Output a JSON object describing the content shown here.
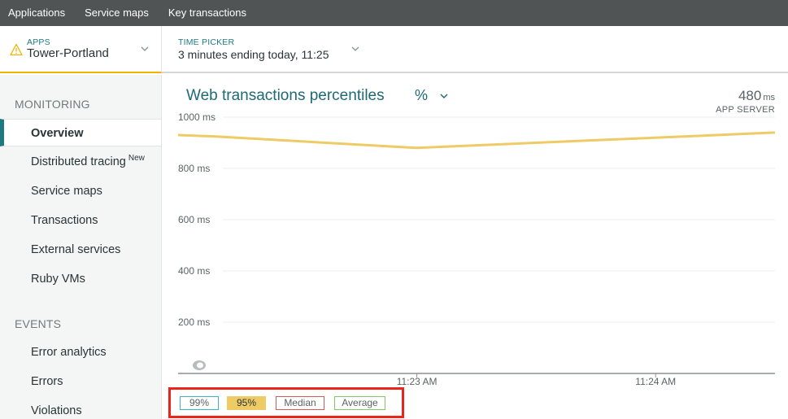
{
  "topnav": [
    "Applications",
    "Service maps",
    "Key transactions"
  ],
  "apps": {
    "label": "APPS",
    "name": "Tower-Portland"
  },
  "timepicker": {
    "label": "TIME PICKER",
    "value": "3 minutes ending today, 11:25"
  },
  "sidebar": {
    "monitoring_title": "MONITORING",
    "monitoring_items": [
      {
        "label": "Overview",
        "badge": ""
      },
      {
        "label": "Distributed tracing",
        "badge": "New"
      },
      {
        "label": "Service maps",
        "badge": ""
      },
      {
        "label": "Transactions",
        "badge": ""
      },
      {
        "label": "External services",
        "badge": ""
      },
      {
        "label": "Ruby VMs",
        "badge": ""
      }
    ],
    "events_title": "EVENTS",
    "events_items": [
      {
        "label": "Error analytics"
      },
      {
        "label": "Errors"
      },
      {
        "label": "Violations"
      }
    ]
  },
  "chart_header": {
    "title": "Web transactions percentiles",
    "unit_toggle": "%",
    "metric_value": "480",
    "metric_unit": "ms",
    "metric_label": "APP SERVER"
  },
  "colors": {
    "p99": "#3ab3c9",
    "p95": "#efcb66",
    "median": "#d45a5a",
    "average": "#84c765",
    "accent": "#1d7a85"
  },
  "legend": [
    {
      "label": "99%",
      "key": "p99",
      "active": false
    },
    {
      "label": "95%",
      "key": "p95",
      "active": true
    },
    {
      "label": "Median",
      "key": "median",
      "active": false
    },
    {
      "label": "Average",
      "key": "average",
      "active": false
    }
  ],
  "chart_data": {
    "type": "line",
    "y_ticks": [
      "1000 ms",
      "800 ms",
      "600 ms",
      "400 ms",
      "200 ms"
    ],
    "y_tick_values": [
      1000,
      800,
      600,
      400,
      200
    ],
    "ylim": [
      0,
      1000
    ],
    "x_ticks": [
      "11:23 AM",
      "11:24 AM"
    ],
    "x_tick_times": [
      1,
      2
    ],
    "xlim": [
      0,
      2.5
    ],
    "series": [
      {
        "key": "p95",
        "x": [
          0,
          0.15,
          1,
          2.5
        ],
        "y": [
          930,
          925,
          880,
          940
        ]
      }
    ],
    "grid": true
  }
}
